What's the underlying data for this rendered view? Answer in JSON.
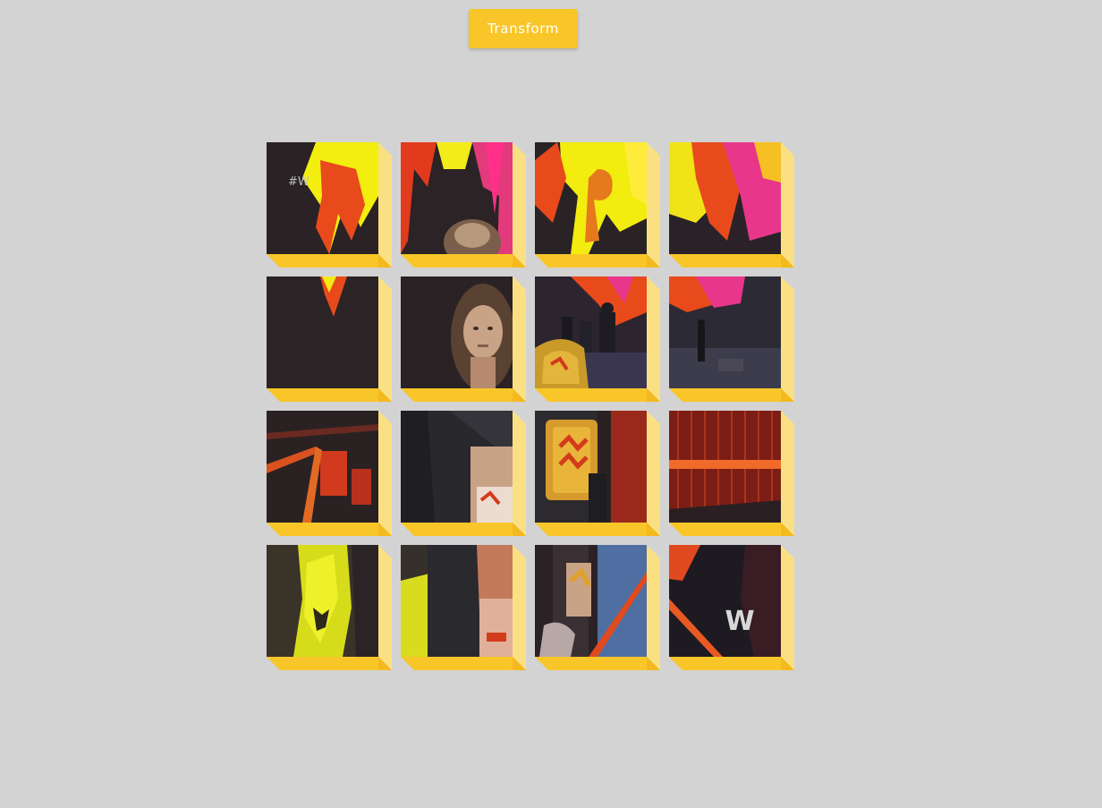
{
  "toolbar": {
    "transform_label": "Transform"
  },
  "image_text": {
    "hashtag": "#W",
    "brand_mark": "W"
  },
  "colors": {
    "background": "#d3d3d3",
    "accent": "#f9c62a",
    "accent_light": "#fbe083",
    "button_text": "#ffffff"
  },
  "grid": {
    "rows": 4,
    "columns": 4,
    "tile_count": 16
  }
}
